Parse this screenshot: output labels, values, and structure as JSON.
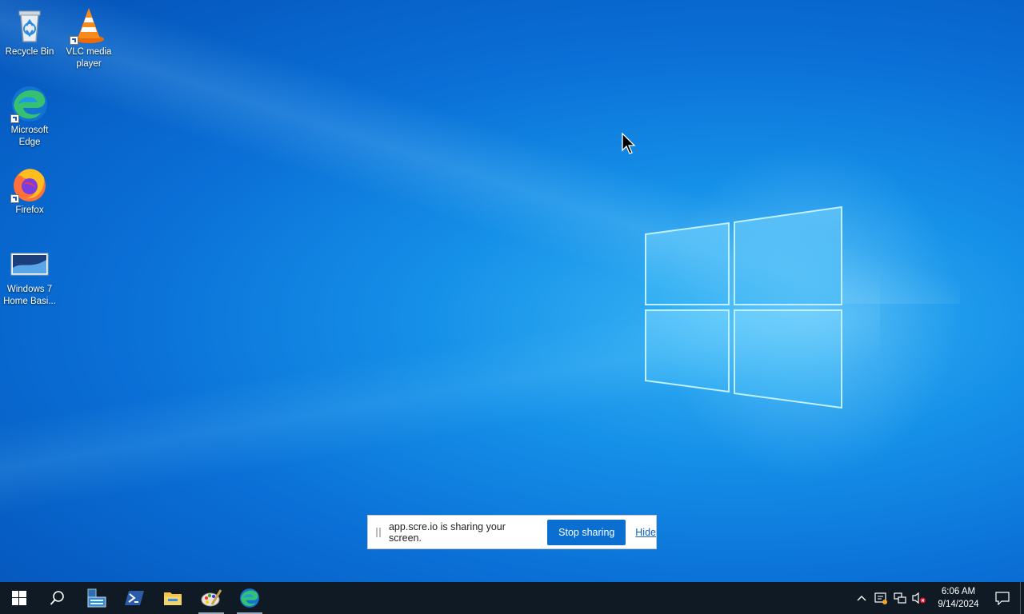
{
  "desktop": {
    "icons": [
      {
        "label": "Recycle Bin",
        "icon": "recycle-bin-icon"
      },
      {
        "label": "VLC media player",
        "icon": "vlc-icon"
      },
      {
        "label": "Microsoft Edge",
        "icon": "edge-icon"
      },
      {
        "label": "Firefox",
        "icon": "firefox-icon"
      },
      {
        "label": "Windows 7 Home Basi...",
        "icon": "image-file-icon"
      }
    ]
  },
  "share_bar": {
    "message": "app.scre.io is sharing your screen.",
    "stop_label": "Stop sharing",
    "hide_label": "Hide"
  },
  "taskbar": {
    "apps": [
      {
        "icon": "start-icon"
      },
      {
        "icon": "search-icon"
      },
      {
        "icon": "server-manager-icon"
      },
      {
        "icon": "powershell-icon"
      },
      {
        "icon": "file-explorer-icon"
      },
      {
        "icon": "paint-icon",
        "active": true
      },
      {
        "icon": "edge-icon",
        "active": true
      }
    ],
    "tray": {
      "icons": [
        "chevron-up-icon",
        "security-icon",
        "network-icon",
        "volume-muted-icon"
      ],
      "time": "6:06 AM",
      "date": "9/14/2024"
    }
  },
  "colors": {
    "accent": "#0b6fd1",
    "taskbar": "#0f1a24",
    "wallpaper": "#0a6fd6"
  }
}
